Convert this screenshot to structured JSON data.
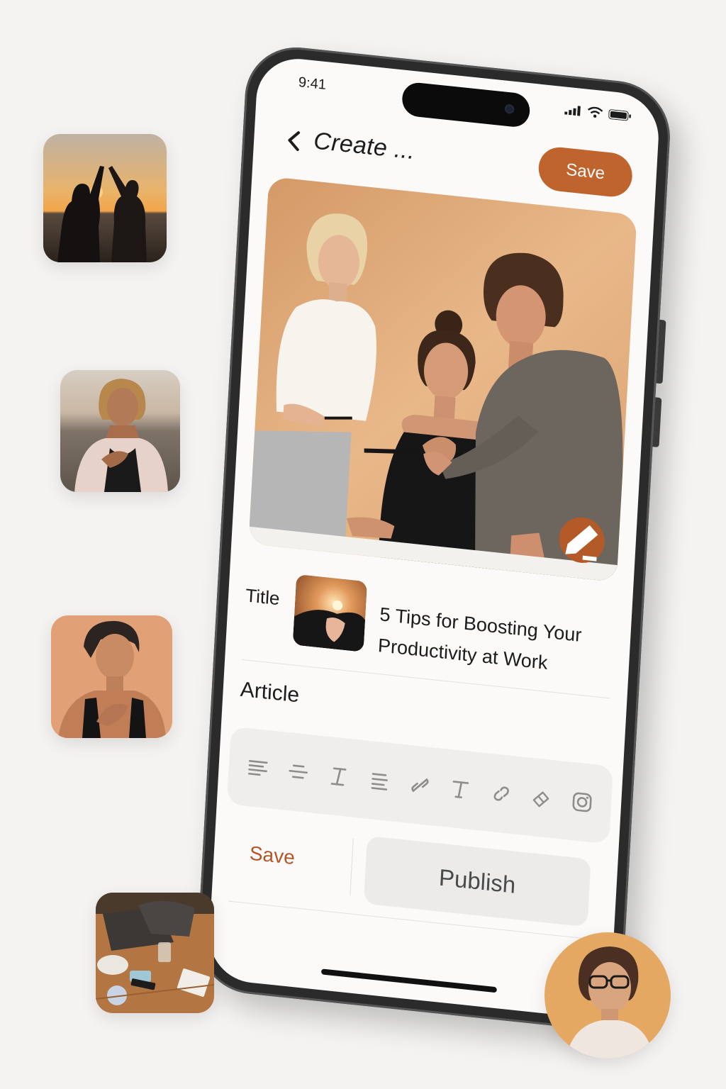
{
  "status_bar": {
    "time": "9:41"
  },
  "nav": {
    "title": "Create ...",
    "save_label": "Save"
  },
  "title_field": {
    "label": "Title",
    "value": "5 Tips for Boosting Your Productivity at Work"
  },
  "article": {
    "label": "Article",
    "toolbar": [
      "align-left-icon",
      "align-center-icon",
      "italic-icon",
      "list-icon",
      "link-icon",
      "text-icon",
      "link-icon",
      "eraser-icon",
      "camera-icon"
    ]
  },
  "actions": {
    "save_label": "Save",
    "publish_label": "Publish"
  },
  "colors": {
    "accent": "#c0642e",
    "accent_dark": "#b45a28",
    "background": "#f4f3f1",
    "toolbar_bg": "#efeeec"
  }
}
